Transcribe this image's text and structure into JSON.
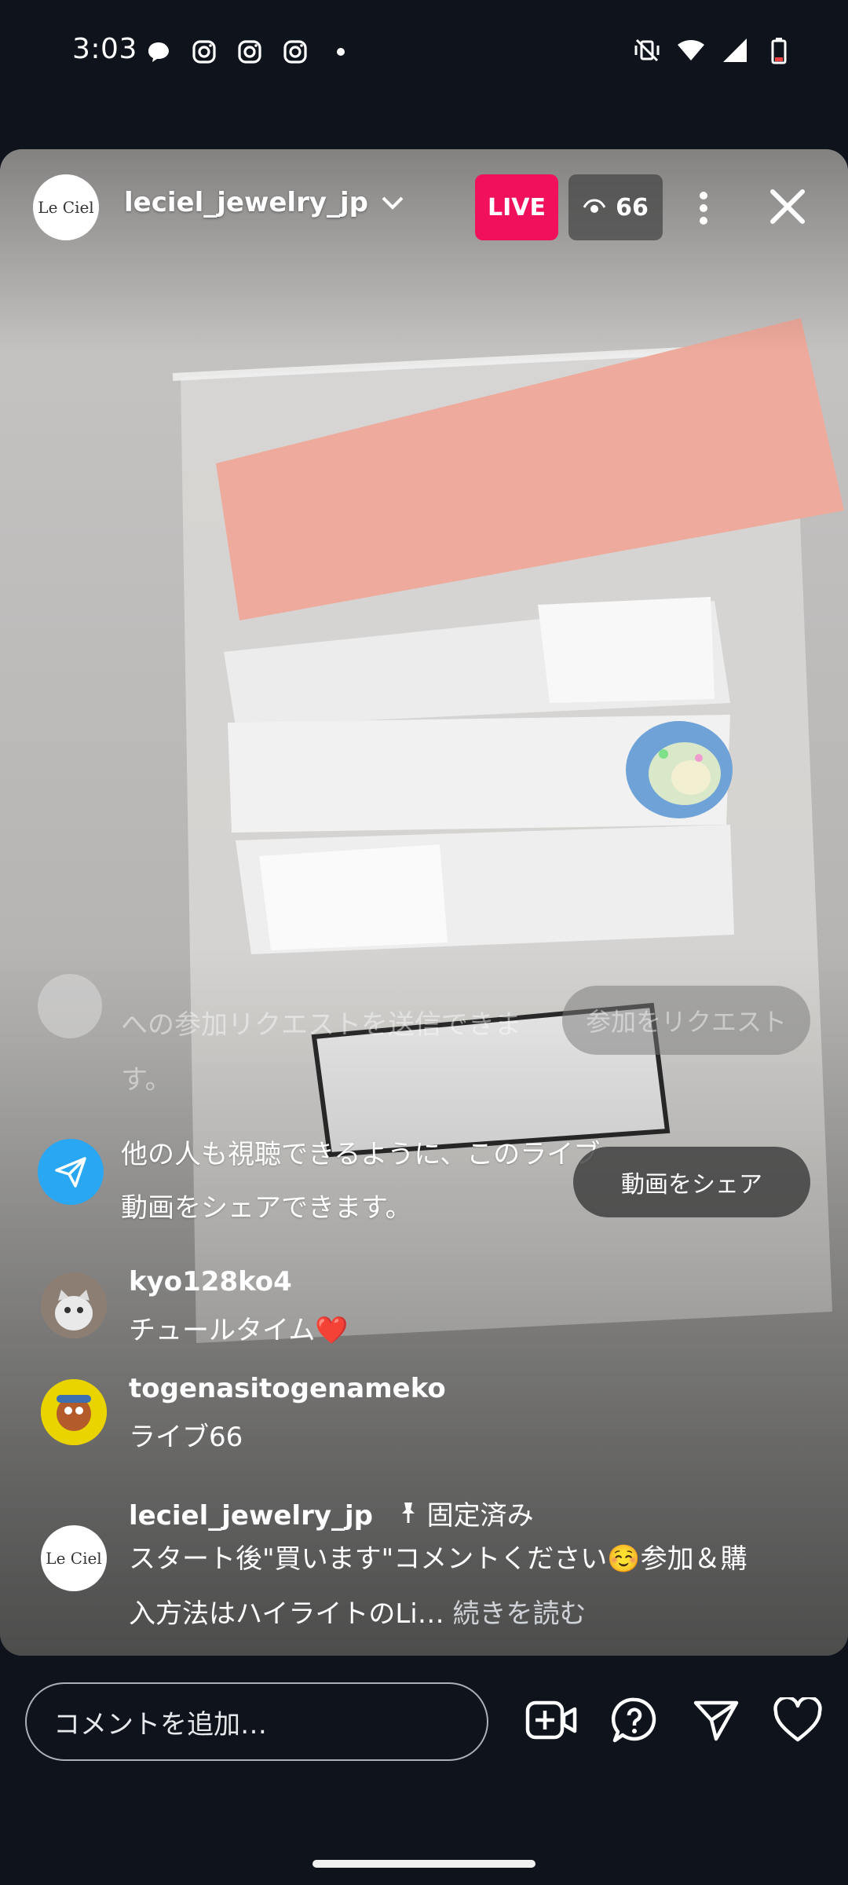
{
  "status_bar": {
    "time": "3:03",
    "left_icons": [
      "chat-bubble-icon",
      "instagram-icon",
      "instagram-icon",
      "instagram-icon",
      "dot-icon"
    ],
    "right_icons": [
      "vibrate-off-icon",
      "wifi-icon",
      "signal-icon",
      "battery-icon"
    ]
  },
  "live": {
    "host_username": "leciel_jewelry_jp",
    "host_avatar_logo": "Le Ciel",
    "live_label": "LIVE",
    "viewer_count": "66"
  },
  "notices": {
    "join_request_text": "への参加リクエストを送信できます。",
    "join_request_button": "参加をリクエスト",
    "share_text": "他の人も視聴できるように、このライブ動画をシェアできます。",
    "share_button": "動画をシェア"
  },
  "comments": [
    {
      "username": "kyo128ko4",
      "text": "チュールタイム❤️"
    },
    {
      "username": "togenasitogenameko",
      "text": "ライブ66"
    }
  ],
  "pinned_comment": {
    "username": "leciel_jewelry_jp",
    "pinned_label": "固定済み",
    "text": "スタート後\"買います\"コメントください☺️参加＆購入方法はハイライトのLi…",
    "read_more": "続きを読む"
  },
  "bottom_bar": {
    "comment_placeholder": "コメントを追加…",
    "icons": [
      "add-video-icon",
      "question-icon",
      "send-icon",
      "heart-icon"
    ]
  },
  "colors": {
    "live_red": "#f0105c",
    "share_blue": "#2aa7f2",
    "background": "#0f131b"
  }
}
